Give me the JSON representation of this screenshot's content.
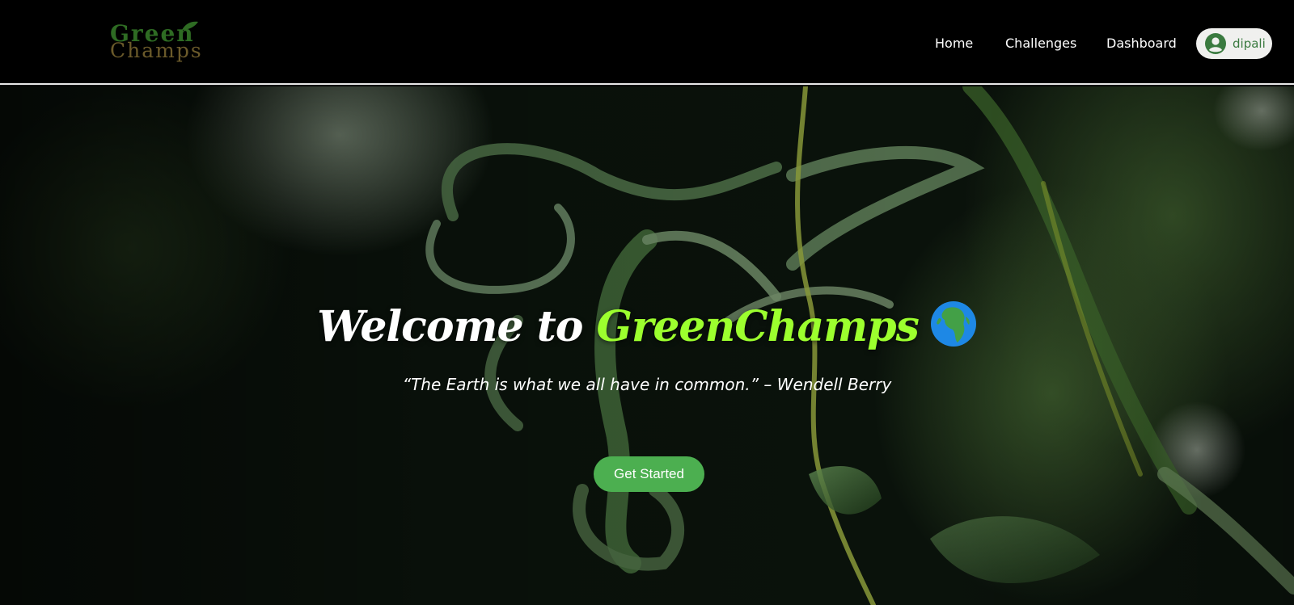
{
  "brand": {
    "logo_line1": "Green",
    "logo_line2": "Champs",
    "logo_colors": {
      "green": "#2e6b23",
      "gold": "#6b5a2a"
    }
  },
  "nav": {
    "items": [
      {
        "label": "Home"
      },
      {
        "label": "Challenges"
      },
      {
        "label": "Dashboard"
      }
    ],
    "user": {
      "name": "dipali",
      "icon": "account-circle-icon"
    }
  },
  "hero": {
    "title_prefix": "Welcome to ",
    "title_brand": "GreenChamps",
    "title_emoji_icon": "globe-africa-icon",
    "quote": "“The Earth is what we all have in common.” – Wendell Berry",
    "cta_label": "Get Started",
    "background": "dark green willow leaves photo"
  },
  "colors": {
    "accent": "#9cff2e",
    "button": "#4caf50",
    "nav_bg": "#000000",
    "text": "#ffffff"
  }
}
